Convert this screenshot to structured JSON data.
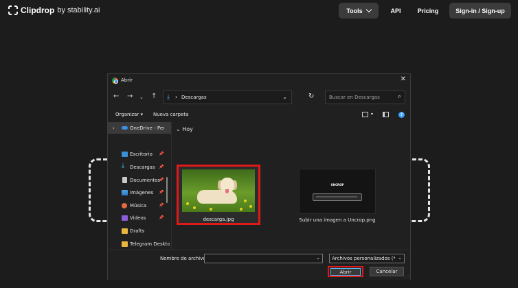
{
  "header": {
    "brand": "Clipdrop",
    "brand_suffix": "by stability.ai",
    "nav": {
      "tools": "Tools",
      "api": "API",
      "pricing": "Pricing",
      "signin": "Sign-in / Sign-up"
    }
  },
  "dialog": {
    "title": "Abrir",
    "path": "Descargas",
    "search_placeholder": "Buscar en Descargas",
    "commands": {
      "organize": "Organizar ▾",
      "new_folder": "Nueva carpeta"
    },
    "sidebar": [
      {
        "label": "OneDrive - Pers",
        "icon": "onedrive-icon"
      },
      {
        "label": "Escritorio",
        "icon": "desktop-icon"
      },
      {
        "label": "Descargas",
        "icon": "downloads-icon"
      },
      {
        "label": "Documentos",
        "icon": "documents-icon"
      },
      {
        "label": "Imágenes",
        "icon": "pictures-icon"
      },
      {
        "label": "Música",
        "icon": "music-icon"
      },
      {
        "label": "Videos",
        "icon": "videos-icon"
      },
      {
        "label": "Drafts",
        "icon": "folder-icon"
      },
      {
        "label": "Telegram Deskto",
        "icon": "folder-icon"
      }
    ],
    "group": "Hoy",
    "files": [
      {
        "name": "descarga.jpg",
        "selected": true
      },
      {
        "name": "Subir una imagen a Uncrop.png",
        "selected": false
      }
    ],
    "thumb2_title": "UNCROP",
    "filename_label": "Nombre de archivo:",
    "filename_value": "",
    "filetype": "Archivos personalizados (*.png",
    "buttons": {
      "open": "Abrir",
      "cancel": "Cancelar"
    },
    "highlight_color": "#e0191b"
  }
}
